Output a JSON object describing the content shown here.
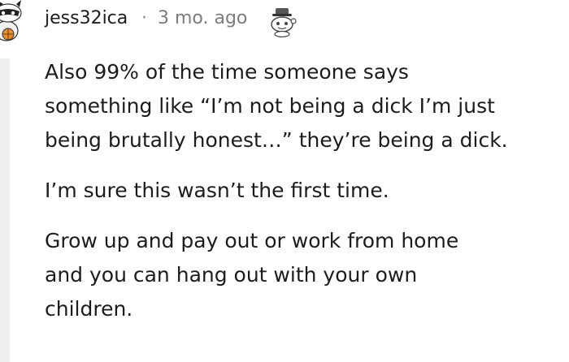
{
  "comment": {
    "author": "jess32ica",
    "separator": "·",
    "time_ago": "3 mo. ago",
    "paragraphs": [
      "Also 99% of the time someone says\nsomething like “I’m not being a dick I’m just\nbeing brutally honest…” they’re being a dick.",
      "I’m sure this wasn’t the first time.",
      "Grow up and pay out or work from home\nand you can hang out with your own\nchildren."
    ],
    "avatar_icon": "snoo-avatar-icon",
    "award_icon": "snoo-award-icon"
  }
}
